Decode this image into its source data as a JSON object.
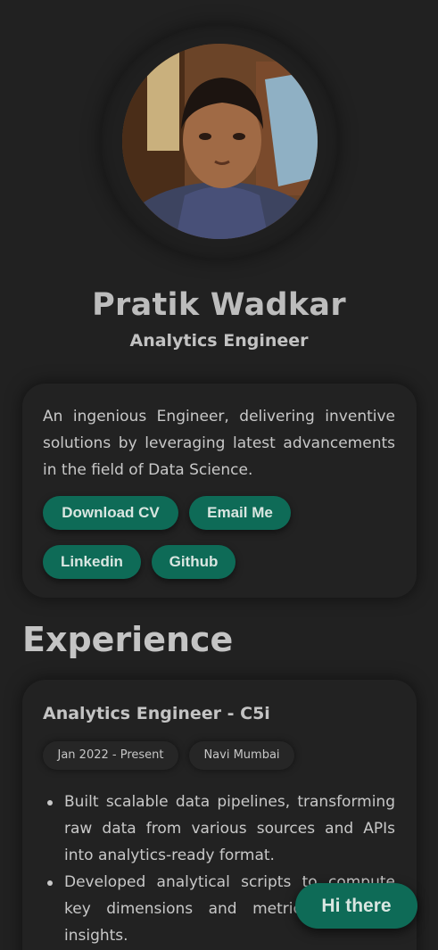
{
  "profile": {
    "name": "Pratik Wadkar",
    "role": "Analytics Engineer",
    "bio": "An ingenious Engineer, delivering inventive solutions by leveraging latest advancements in the field of Data Science."
  },
  "actions": {
    "download_cv": "Download CV",
    "email_me": "Email Me",
    "linkedin": "Linkedin",
    "github": "Github"
  },
  "experience": {
    "section_title": "Experience",
    "jobs": [
      {
        "title": "Analytics Engineer - C5i",
        "date": "Jan 2022 - Present",
        "location": "Navi Mumbai",
        "bullets": [
          "Built scalable data pipelines, transforming raw data from various sources and APIs into analytics-ready format.",
          "Developed analytical scripts to compute key dimensions and metrics, enabling insights."
        ]
      }
    ]
  },
  "chat": {
    "button_label": "Hi there"
  },
  "colors": {
    "background": "#212121",
    "accent": "#0e6b57"
  }
}
